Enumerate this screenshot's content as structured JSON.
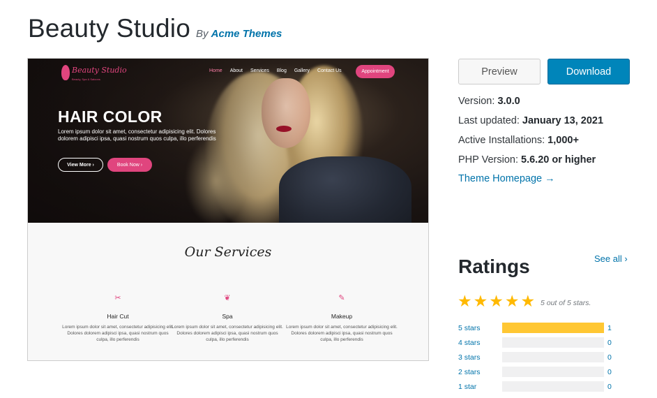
{
  "header": {
    "title": "Beauty Studio",
    "by_prefix": "By",
    "author": "Acme Themes"
  },
  "screenshot": {
    "logo_text": "Beauty Studio",
    "logo_sub": "Beauty, Spa & Saloons",
    "nav": [
      "Home",
      "About",
      "Services",
      "Blog",
      "Gallery",
      "Contact Us"
    ],
    "appointment": "Appointment",
    "hero_title": "HAIR COLOR",
    "hero_text": "Lorem ipsum dolor sit amet, consectetur adipisicing elit. Dolores dolorem adipisci ipsa, quasi nostrum quos culpa, illo perferendis",
    "view_more": "View More  ›",
    "book_now": "Book Now  ›",
    "services_title": "Our Services",
    "services": [
      {
        "name": "Hair Cut",
        "icon": "scissors-icon",
        "desc": "Lorem ipsum dolor sit amet, consectetur adipisicing elit. Dolores dolorem adipisci ipsa, quasi nostrum quos culpa, illo perferendis"
      },
      {
        "name": "Spa",
        "icon": "leaf-icon",
        "desc": "Lorem ipsum dolor sit amet, consectetur adipisicing elit. Dolores dolorem adipisci ipsa, quasi nostrum quos culpa, illo perferendis"
      },
      {
        "name": "Makeup",
        "icon": "brush-icon",
        "desc": "Lorem ipsum dolor sit amet, consectetur adipisicing elit. Dolores dolorem adipisci ipsa, quasi nostrum quos culpa, illo perferendis"
      }
    ]
  },
  "actions": {
    "preview": "Preview",
    "download": "Download"
  },
  "meta": {
    "version_label": "Version:",
    "version": "3.0.0",
    "updated_label": "Last updated:",
    "updated": "January 13, 2021",
    "installs_label": "Active Installations:",
    "installs": "1,000+",
    "php_label": "PHP Version:",
    "php": "5.6.20 or higher",
    "homepage": "Theme Homepage →"
  },
  "ratings": {
    "title": "Ratings",
    "see_all": "See all  ›",
    "stars_text": "5 out of 5 stars.",
    "average_stars": 5,
    "rows": [
      {
        "label": "5 stars",
        "count": "1",
        "fraction": 1.0
      },
      {
        "label": "4 stars",
        "count": "0",
        "fraction": 0
      },
      {
        "label": "3 stars",
        "count": "0",
        "fraction": 0
      },
      {
        "label": "2 stars",
        "count": "0",
        "fraction": 0
      },
      {
        "label": "1 star",
        "count": "0",
        "fraction": 0
      }
    ]
  },
  "colors": {
    "link": "#0073aa",
    "download_bg": "#0085ba",
    "star": "#ffb900",
    "bar_fill": "#ffc733",
    "accent_pink": "#e0457e"
  }
}
